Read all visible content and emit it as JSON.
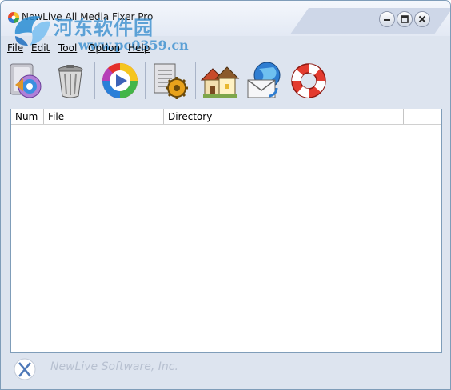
{
  "window": {
    "title": "NewLive All Media Fixer Pro",
    "watermark_cn": "河东软件园",
    "watermark_url": "www.pc0359.cn"
  },
  "menu": {
    "items": [
      {
        "label": "File",
        "name": "menu-file"
      },
      {
        "label": "Edit",
        "name": "menu-edit"
      },
      {
        "label": "Tool",
        "name": "menu-tool"
      },
      {
        "label": "Option",
        "name": "menu-option"
      },
      {
        "label": "Help",
        "name": "menu-help"
      }
    ]
  },
  "toolbar": {
    "icons": [
      "add-media-icon",
      "delete-trash-icon",
      "media-player-icon",
      "settings-document-gear-icon",
      "home-houses-icon",
      "email-globe-icon",
      "help-lifebuoy-icon"
    ]
  },
  "list": {
    "columns": [
      "Num",
      "File",
      "Directory",
      ""
    ],
    "rows": []
  },
  "footer": {
    "company": "NewLive Software, Inc."
  },
  "colors": {
    "window_bg": "#dde4ef",
    "border": "#7f9db9",
    "footer_text": "#b7c0d0"
  }
}
